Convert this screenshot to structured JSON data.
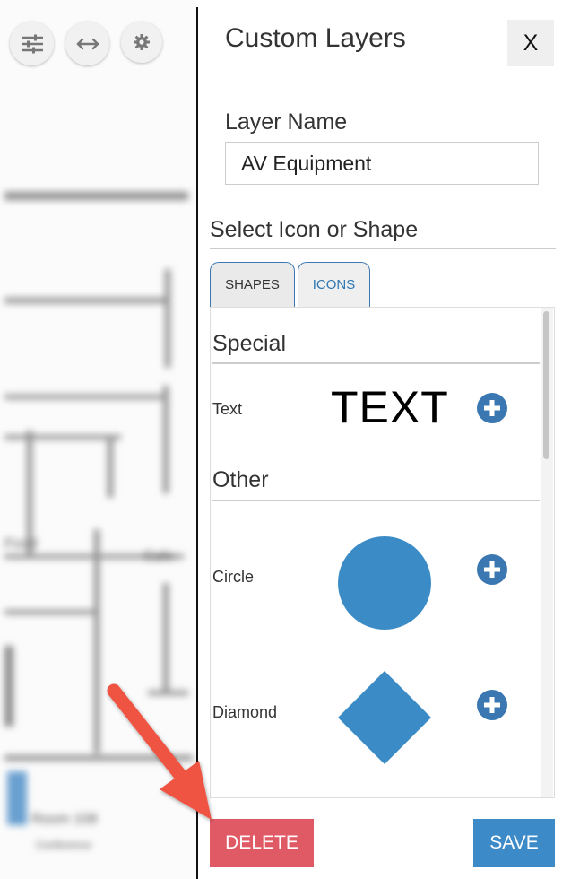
{
  "map": {
    "toolbar": [
      {
        "icon": "sliders-icon"
      },
      {
        "icon": "horizontal-arrows-icon"
      },
      {
        "icon": "gear-icon"
      }
    ]
  },
  "panel": {
    "title": "Custom Layers",
    "close_label": "X",
    "layer_name_label": "Layer Name",
    "layer_name_value": "AV Equipment",
    "select_label": "Select Icon or Shape",
    "tabs": [
      {
        "label": "SHAPES",
        "active": true
      },
      {
        "label": "ICONS",
        "active": false
      }
    ],
    "groups": [
      {
        "title": "Special",
        "items": [
          {
            "label": "Text",
            "preview": "TEXT"
          }
        ]
      },
      {
        "title": "Other",
        "items": [
          {
            "label": "Circle"
          },
          {
            "label": "Diamond"
          }
        ]
      }
    ],
    "delete_label": "DELETE",
    "save_label": "SAVE"
  },
  "colors": {
    "accent_blue": "#3b8cc6",
    "delete_red": "#e05a66",
    "arrow_red": "#ef5343"
  }
}
